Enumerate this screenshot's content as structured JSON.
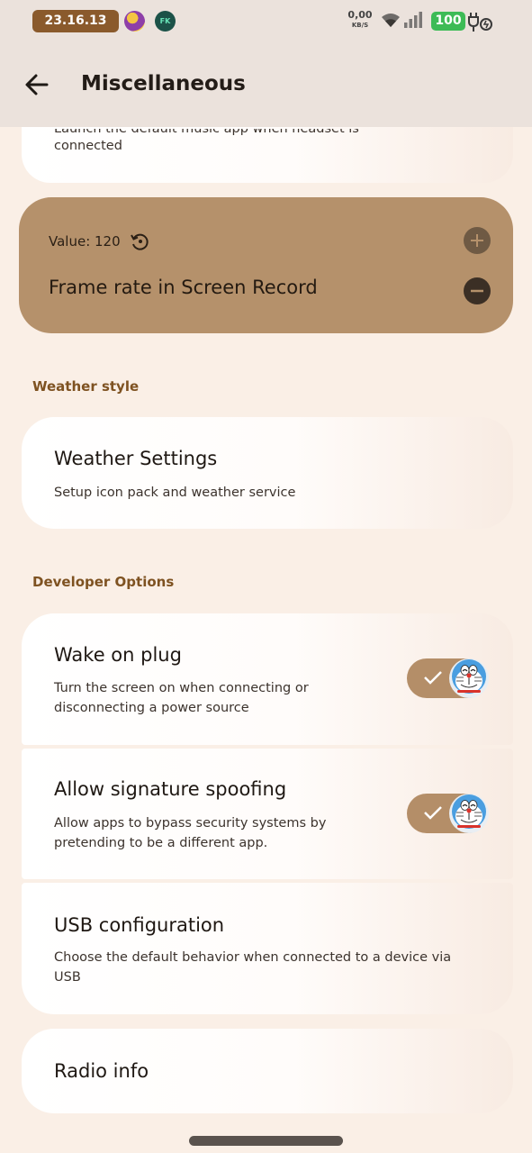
{
  "status_bar": {
    "time": "23.16.13",
    "net_speed_value": "0,00",
    "net_speed_unit": "KB/S",
    "battery": "100",
    "fk_badge": "FK"
  },
  "app_bar": {
    "title": "Miscellaneous",
    "back_icon": "arrow-left-icon"
  },
  "partial_item": {
    "subtitle": "Launch the default music app when headset is connected",
    "subtitle_line1": "Launch the default music app when headset is",
    "subtitle_line2": "connected"
  },
  "framerate": {
    "value_label": "Value: 120",
    "title": "Frame rate in Screen Record",
    "value": 120
  },
  "sections": {
    "weather_header": "Weather style",
    "developer_header": "Developer Options"
  },
  "weather_settings": {
    "title": "Weather Settings",
    "subtitle": "Setup icon pack and weather service"
  },
  "wake_on_plug": {
    "title": "Wake on plug",
    "subtitle": "Turn the screen on when connecting or disconnecting a power source",
    "enabled": true
  },
  "signature_spoofing": {
    "title": "Allow signature spoofing",
    "subtitle": "Allow apps to bypass security systems by pretending to be a different app.",
    "enabled": true
  },
  "usb_configuration": {
    "title": "USB configuration",
    "subtitle": "Choose the default behavior when connected to a device via USB"
  },
  "radio_info": {
    "title": "Radio info"
  },
  "colors": {
    "background": "#faefe6",
    "accent": "#b5916b",
    "section_header": "#7e5221",
    "toggle_on": "#b48e68",
    "battery": "#3dbb56",
    "time_pill": "#8a5a2c"
  }
}
